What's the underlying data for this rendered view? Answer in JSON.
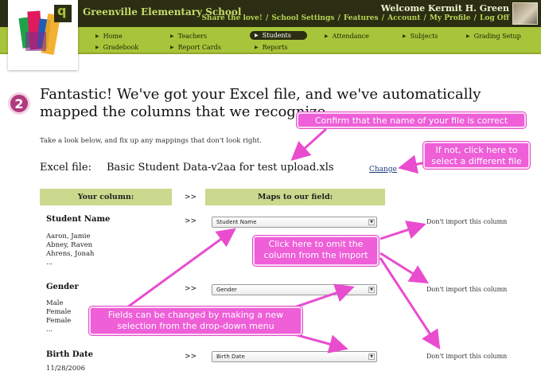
{
  "header": {
    "school_name": "Greenville Elementary School",
    "welcome": "Welcome Kermit H. Green",
    "links": [
      "Share the love!",
      "School Settings",
      "Features",
      "Account",
      "My Profile",
      "Log Off"
    ],
    "logo_letter": "q"
  },
  "nav": {
    "items": [
      "Home",
      "Teachers",
      "Students",
      "Attendance",
      "Subjects",
      "Grading Setup",
      "Gradebook",
      "Report Cards",
      "Reports"
    ],
    "active": "Students"
  },
  "step": {
    "number": "2",
    "heading": "Fantastic! We've got your Excel file, and we've automatically mapped the columns that we recognize.",
    "intro": "Take a look below, and fix up any mappings that don't look right."
  },
  "file": {
    "label": "Excel file:",
    "name": "Basic Student Data-v2aa for test upload.xls",
    "change_link": "Change"
  },
  "mapping": {
    "col_yours": "Your column:",
    "arrow": ">>",
    "col_ours": "Maps to our field:",
    "dont_import": "Don't import this column",
    "rows": [
      {
        "field": "Student Name",
        "samples": [
          "Aaron, Jamie",
          "Abney, Raven",
          "Ahrens, Jonah",
          "..."
        ],
        "selected": "Student Name"
      },
      {
        "field": "Gender",
        "samples": [
          "Male",
          "Female",
          "Female",
          "..."
        ],
        "selected": "Gender"
      },
      {
        "field": "Birth Date",
        "samples": [
          "11/28/2006"
        ],
        "selected": "Birth Date"
      }
    ]
  },
  "callouts": {
    "confirm_file": "Confirm that the name of your file is correct",
    "change_file": "If not, click here to select a different file",
    "omit_column": "Click here to omit the column from the import",
    "fields_change": "Fields can be changed by making a new selection from the drop-down menu"
  },
  "colors": {
    "dark_bar": "#2b2e12",
    "green_bar": "#a8c43a",
    "column_header": "#cad98d",
    "callout": "#ee5fd8",
    "step_badge": "#b03b7e"
  }
}
